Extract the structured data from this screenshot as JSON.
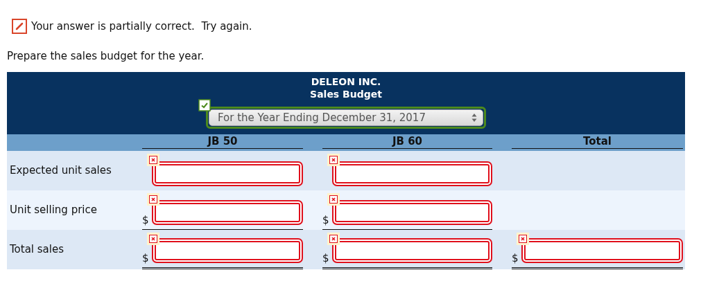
{
  "status": {
    "partial": true,
    "text": "Your answer is partially correct.  Try again."
  },
  "prompt": "Prepare the sales budget for the year.",
  "budget": {
    "title_lines": [
      "DELEON INC.",
      "Sales Budget"
    ],
    "period": {
      "value": "For the Year Ending December 31, 2017",
      "correct": true
    },
    "columns": [
      "JB 50",
      "JB 60",
      "Total"
    ],
    "rows": [
      {
        "label": "Expected unit sales",
        "underlined": false,
        "cells": [
          {
            "kind": "input",
            "correct": false
          },
          {
            "kind": "input",
            "correct": false
          },
          {
            "kind": "empty"
          }
        ]
      },
      {
        "label": "Unit selling price",
        "underlined": true,
        "double_underlined": false,
        "cells": [
          {
            "kind": "input",
            "prefix": "$",
            "correct": false
          },
          {
            "kind": "input",
            "prefix": "$",
            "correct": false
          },
          {
            "kind": "empty"
          }
        ]
      },
      {
        "label": "Total sales",
        "underlined": true,
        "double_underlined": true,
        "cells": [
          {
            "kind": "input",
            "prefix": "$",
            "correct": false
          },
          {
            "kind": "input",
            "prefix": "$",
            "correct": false
          },
          {
            "kind": "input",
            "prefix": "$",
            "correct": false
          }
        ]
      }
    ]
  }
}
